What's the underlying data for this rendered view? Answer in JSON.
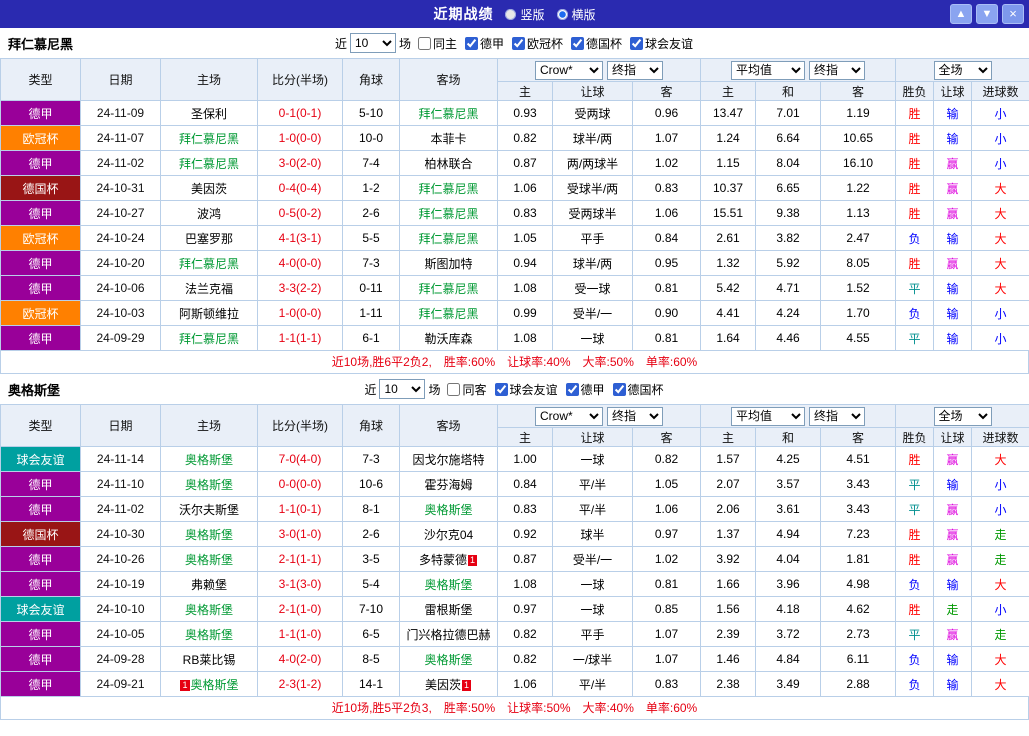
{
  "titlebar": {
    "title": "近期战绩",
    "layout_options": [
      {
        "label": "竖版",
        "selected": false
      },
      {
        "label": "横版",
        "selected": true
      }
    ],
    "up_button": "▲",
    "down_button": "▼",
    "close_button": "×"
  },
  "table_header": {
    "type": "类型",
    "date": "日期",
    "home": "主场",
    "score": "比分(半场)",
    "corner": "角球",
    "away": "客场",
    "odds_selects": [
      "Crow*",
      "终指"
    ],
    "odds_cols": [
      "主",
      "让球",
      "客"
    ],
    "avg_selects": [
      "平均值",
      "终指"
    ],
    "avg_cols": [
      "主",
      "和",
      "客"
    ],
    "result_select": "全场",
    "result_cols": [
      "胜负",
      "让球",
      "进球数"
    ]
  },
  "colors": {
    "league": {
      "德甲": "#990099",
      "欧冠杯": "#ff8000",
      "德国杯": "#991515",
      "球会友谊": "#00a0a0"
    },
    "result": {
      "胜": "#ff0000",
      "平": "#009090",
      "负": "#0000ff",
      "赢": "#dd00dd",
      "输": "#0000ff",
      "走": "#009900",
      "大": "#ff0000",
      "小": "#0000ff"
    },
    "score": "#e60012",
    "focus_team": "#009933",
    "badge": "#e60012"
  },
  "sections": [
    {
      "team": "拜仁慕尼黑",
      "filter": {
        "near_label": "近",
        "count": "10",
        "matches_label": "场",
        "same": {
          "label": "同主",
          "checked": false
        },
        "leagues": [
          {
            "label": "德甲",
            "checked": true
          },
          {
            "label": "欧冠杯",
            "checked": true
          },
          {
            "label": "德国杯",
            "checked": true
          },
          {
            "label": "球会友谊",
            "checked": true
          }
        ]
      },
      "rows": [
        {
          "league": "德甲",
          "date": "24-11-09",
          "home": "圣保利",
          "home_focus": false,
          "score": "0-1(0-1)",
          "corner": "5-10",
          "away": "拜仁慕尼黑",
          "away_focus": true,
          "odds": [
            "0.93",
            "受两球",
            "0.96"
          ],
          "avg": [
            "13.47",
            "7.01",
            "1.19"
          ],
          "results": [
            "胜",
            "输",
            "小"
          ]
        },
        {
          "league": "欧冠杯",
          "date": "24-11-07",
          "home": "拜仁慕尼黑",
          "home_focus": true,
          "score": "1-0(0-0)",
          "corner": "10-0",
          "away": "本菲卡",
          "away_focus": false,
          "odds": [
            "0.82",
            "球半/两",
            "1.07"
          ],
          "avg": [
            "1.24",
            "6.64",
            "10.65"
          ],
          "results": [
            "胜",
            "输",
            "小"
          ]
        },
        {
          "league": "德甲",
          "date": "24-11-02",
          "home": "拜仁慕尼黑",
          "home_focus": true,
          "score": "3-0(2-0)",
          "corner": "7-4",
          "away": "柏林联合",
          "away_focus": false,
          "odds": [
            "0.87",
            "两/两球半",
            "1.02"
          ],
          "avg": [
            "1.15",
            "8.04",
            "16.10"
          ],
          "results": [
            "胜",
            "赢",
            "小"
          ]
        },
        {
          "league": "德国杯",
          "date": "24-10-31",
          "home": "美因茨",
          "home_focus": false,
          "score": "0-4(0-4)",
          "corner": "1-2",
          "away": "拜仁慕尼黑",
          "away_focus": true,
          "odds": [
            "1.06",
            "受球半/两",
            "0.83"
          ],
          "avg": [
            "10.37",
            "6.65",
            "1.22"
          ],
          "results": [
            "胜",
            "赢",
            "大"
          ]
        },
        {
          "league": "德甲",
          "date": "24-10-27",
          "home": "波鸿",
          "home_focus": false,
          "score": "0-5(0-2)",
          "corner": "2-6",
          "away": "拜仁慕尼黑",
          "away_focus": true,
          "odds": [
            "0.83",
            "受两球半",
            "1.06"
          ],
          "avg": [
            "15.51",
            "9.38",
            "1.13"
          ],
          "results": [
            "胜",
            "赢",
            "大"
          ]
        },
        {
          "league": "欧冠杯",
          "date": "24-10-24",
          "home": "巴塞罗那",
          "home_focus": false,
          "score": "4-1(3-1)",
          "corner": "5-5",
          "away": "拜仁慕尼黑",
          "away_focus": true,
          "odds": [
            "1.05",
            "平手",
            "0.84"
          ],
          "avg": [
            "2.61",
            "3.82",
            "2.47"
          ],
          "results": [
            "负",
            "输",
            "大"
          ]
        },
        {
          "league": "德甲",
          "date": "24-10-20",
          "home": "拜仁慕尼黑",
          "home_focus": true,
          "score": "4-0(0-0)",
          "corner": "7-3",
          "away": "斯图加特",
          "away_focus": false,
          "odds": [
            "0.94",
            "球半/两",
            "0.95"
          ],
          "avg": [
            "1.32",
            "5.92",
            "8.05"
          ],
          "results": [
            "胜",
            "赢",
            "大"
          ]
        },
        {
          "league": "德甲",
          "date": "24-10-06",
          "home": "法兰克福",
          "home_focus": false,
          "score": "3-3(2-2)",
          "corner": "0-11",
          "away": "拜仁慕尼黑",
          "away_focus": true,
          "odds": [
            "1.08",
            "受一球",
            "0.81"
          ],
          "avg": [
            "5.42",
            "4.71",
            "1.52"
          ],
          "results": [
            "平",
            "输",
            "大"
          ]
        },
        {
          "league": "欧冠杯",
          "date": "24-10-03",
          "home": "阿斯顿维拉",
          "home_focus": false,
          "score": "1-0(0-0)",
          "corner": "1-11",
          "away": "拜仁慕尼黑",
          "away_focus": true,
          "odds": [
            "0.99",
            "受半/一",
            "0.90"
          ],
          "avg": [
            "4.41",
            "4.24",
            "1.70"
          ],
          "results": [
            "负",
            "输",
            "小"
          ]
        },
        {
          "league": "德甲",
          "date": "24-09-29",
          "home": "拜仁慕尼黑",
          "home_focus": true,
          "score": "1-1(1-1)",
          "corner": "6-1",
          "away": "勒沃库森",
          "away_focus": false,
          "odds": [
            "1.08",
            "一球",
            "0.81"
          ],
          "avg": [
            "1.64",
            "4.46",
            "4.55"
          ],
          "results": [
            "平",
            "输",
            "小"
          ]
        }
      ],
      "summary": {
        "lead": "近10场,胜6平2负2,",
        "stats": [
          "胜率:60%",
          "让球率:40%",
          "大率:50%",
          "单率:60%"
        ]
      }
    },
    {
      "team": "奥格斯堡",
      "filter": {
        "near_label": "近",
        "count": "10",
        "matches_label": "场",
        "same": {
          "label": "同客",
          "checked": false
        },
        "leagues": [
          {
            "label": "球会友谊",
            "checked": true
          },
          {
            "label": "德甲",
            "checked": true
          },
          {
            "label": "德国杯",
            "checked": true
          }
        ]
      },
      "rows": [
        {
          "league": "球会友谊",
          "date": "24-11-14",
          "home": "奥格斯堡",
          "home_focus": true,
          "score": "7-0(4-0)",
          "corner": "7-3",
          "away": "因戈尔施塔特",
          "away_focus": false,
          "odds": [
            "1.00",
            "一球",
            "0.82"
          ],
          "avg": [
            "1.57",
            "4.25",
            "4.51"
          ],
          "results": [
            "胜",
            "赢",
            "大"
          ]
        },
        {
          "league": "德甲",
          "date": "24-11-10",
          "home": "奥格斯堡",
          "home_focus": true,
          "score": "0-0(0-0)",
          "corner": "10-6",
          "away": "霍芬海姆",
          "away_focus": false,
          "odds": [
            "0.84",
            "平/半",
            "1.05"
          ],
          "avg": [
            "2.07",
            "3.57",
            "3.43"
          ],
          "results": [
            "平",
            "输",
            "小"
          ]
        },
        {
          "league": "德甲",
          "date": "24-11-02",
          "home": "沃尔夫斯堡",
          "home_focus": false,
          "score": "1-1(0-1)",
          "corner": "8-1",
          "away": "奥格斯堡",
          "away_focus": true,
          "odds": [
            "0.83",
            "平/半",
            "1.06"
          ],
          "avg": [
            "2.06",
            "3.61",
            "3.43"
          ],
          "results": [
            "平",
            "赢",
            "小"
          ]
        },
        {
          "league": "德国杯",
          "date": "24-10-30",
          "home": "奥格斯堡",
          "home_focus": true,
          "score": "3-0(1-0)",
          "corner": "2-6",
          "away": "沙尔克04",
          "away_focus": false,
          "odds": [
            "0.92",
            "球半",
            "0.97"
          ],
          "avg": [
            "1.37",
            "4.94",
            "7.23"
          ],
          "results": [
            "胜",
            "赢",
            "走"
          ]
        },
        {
          "league": "德甲",
          "date": "24-10-26",
          "home": "奥格斯堡",
          "home_focus": true,
          "score": "2-1(1-1)",
          "corner": "3-5",
          "away": "多特蒙德",
          "away_focus": false,
          "away_badge": "1",
          "away_badge_pos": "after",
          "odds": [
            "0.87",
            "受半/一",
            "1.02"
          ],
          "avg": [
            "3.92",
            "4.04",
            "1.81"
          ],
          "results": [
            "胜",
            "赢",
            "走"
          ]
        },
        {
          "league": "德甲",
          "date": "24-10-19",
          "home": "弗赖堡",
          "home_focus": false,
          "score": "3-1(3-0)",
          "corner": "5-4",
          "away": "奥格斯堡",
          "away_focus": true,
          "odds": [
            "1.08",
            "一球",
            "0.81"
          ],
          "avg": [
            "1.66",
            "3.96",
            "4.98"
          ],
          "results": [
            "负",
            "输",
            "大"
          ]
        },
        {
          "league": "球会友谊",
          "date": "24-10-10",
          "home": "奥格斯堡",
          "home_focus": true,
          "score": "2-1(1-0)",
          "corner": "7-10",
          "away": "雷根斯堡",
          "away_focus": false,
          "odds": [
            "0.97",
            "一球",
            "0.85"
          ],
          "avg": [
            "1.56",
            "4.18",
            "4.62"
          ],
          "results": [
            "胜",
            "走",
            "小"
          ]
        },
        {
          "league": "德甲",
          "date": "24-10-05",
          "home": "奥格斯堡",
          "home_focus": true,
          "score": "1-1(1-0)",
          "corner": "6-5",
          "away": "门兴格拉德巴赫",
          "away_focus": false,
          "odds": [
            "0.82",
            "平手",
            "1.07"
          ],
          "avg": [
            "2.39",
            "3.72",
            "2.73"
          ],
          "results": [
            "平",
            "赢",
            "走"
          ]
        },
        {
          "league": "德甲",
          "date": "24-09-28",
          "home": "RB莱比锡",
          "home_focus": false,
          "score": "4-0(2-0)",
          "corner": "8-5",
          "away": "奥格斯堡",
          "away_focus": true,
          "odds": [
            "0.82",
            "一/球半",
            "1.07"
          ],
          "avg": [
            "1.46",
            "4.84",
            "6.11"
          ],
          "results": [
            "负",
            "输",
            "大"
          ]
        },
        {
          "league": "德甲",
          "date": "24-09-21",
          "home": "奥格斯堡",
          "home_focus": true,
          "home_badge": "1",
          "home_badge_pos": "before",
          "score": "2-3(1-2)",
          "corner": "14-1",
          "away": "美因茨",
          "away_focus": false,
          "away_badge": "1",
          "away_badge_pos": "after",
          "odds": [
            "1.06",
            "平/半",
            "0.83"
          ],
          "avg": [
            "2.38",
            "3.49",
            "2.88"
          ],
          "results": [
            "负",
            "输",
            "大"
          ]
        }
      ],
      "summary": {
        "lead": "近10场,胜5平2负3,",
        "stats": [
          "胜率:50%",
          "让球率:50%",
          "大率:40%",
          "单率:60%"
        ]
      }
    }
  ]
}
